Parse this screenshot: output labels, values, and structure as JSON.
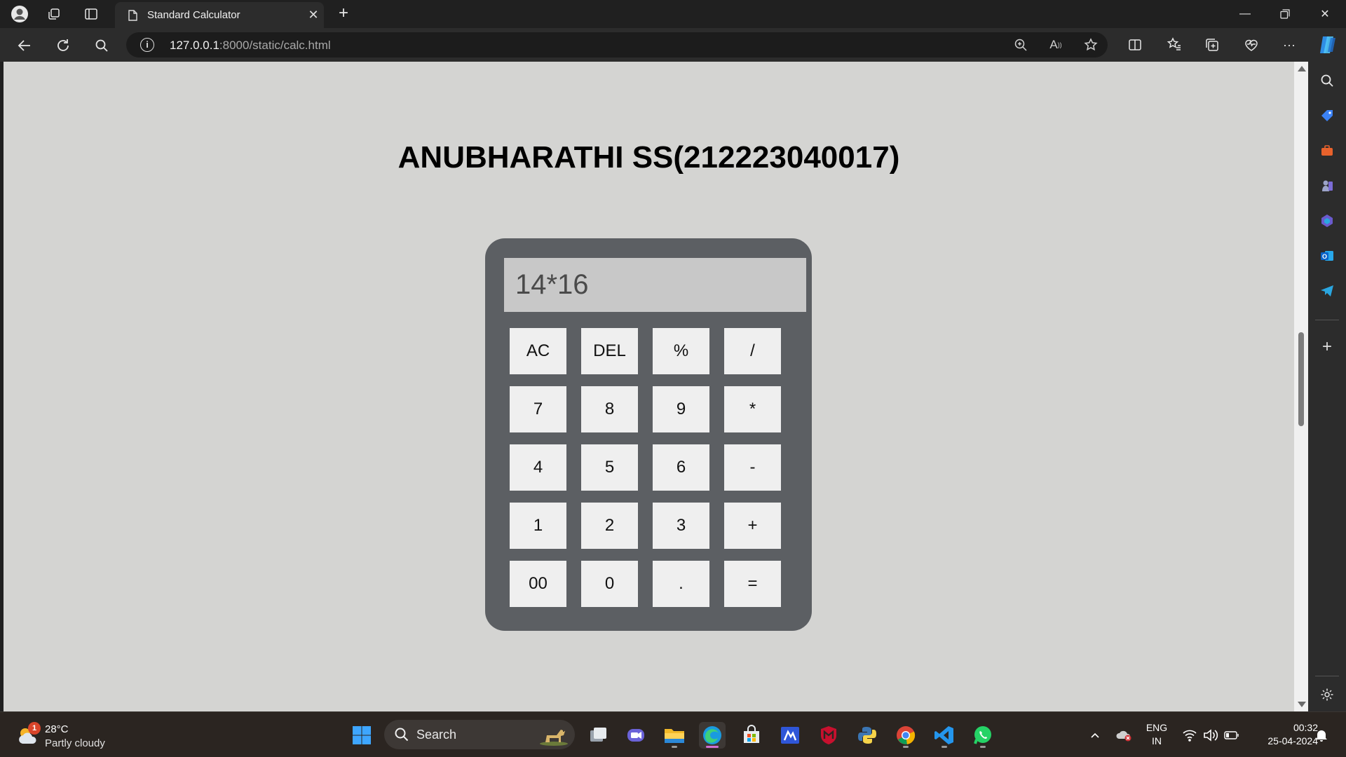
{
  "browser": {
    "tab_title": "Standard Calculator",
    "url_host": "127.0.0.1",
    "url_rest": ":8000/static/calc.html"
  },
  "page": {
    "title": "ANUBHARATHI SS(212223040017)"
  },
  "calculator": {
    "display": "14*16",
    "keys": [
      "AC",
      "DEL",
      "%",
      "/",
      "7",
      "8",
      "9",
      "*",
      "4",
      "5",
      "6",
      "-",
      "1",
      "2",
      "3",
      "+",
      "00",
      "0",
      ".",
      "="
    ]
  },
  "taskbar": {
    "weather_temp": "28°C",
    "weather_condition": "Partly cloudy",
    "weather_badge": "1",
    "search_label": "Search",
    "lang_line1": "ENG",
    "lang_line2": "IN",
    "time": "00:32",
    "date": "25-04-2024"
  },
  "colors": {
    "page_background": "#d4d4d2",
    "calculator_body": "#5c5f63",
    "display_background": "#c8c8c8",
    "key_background": "#efefef"
  }
}
